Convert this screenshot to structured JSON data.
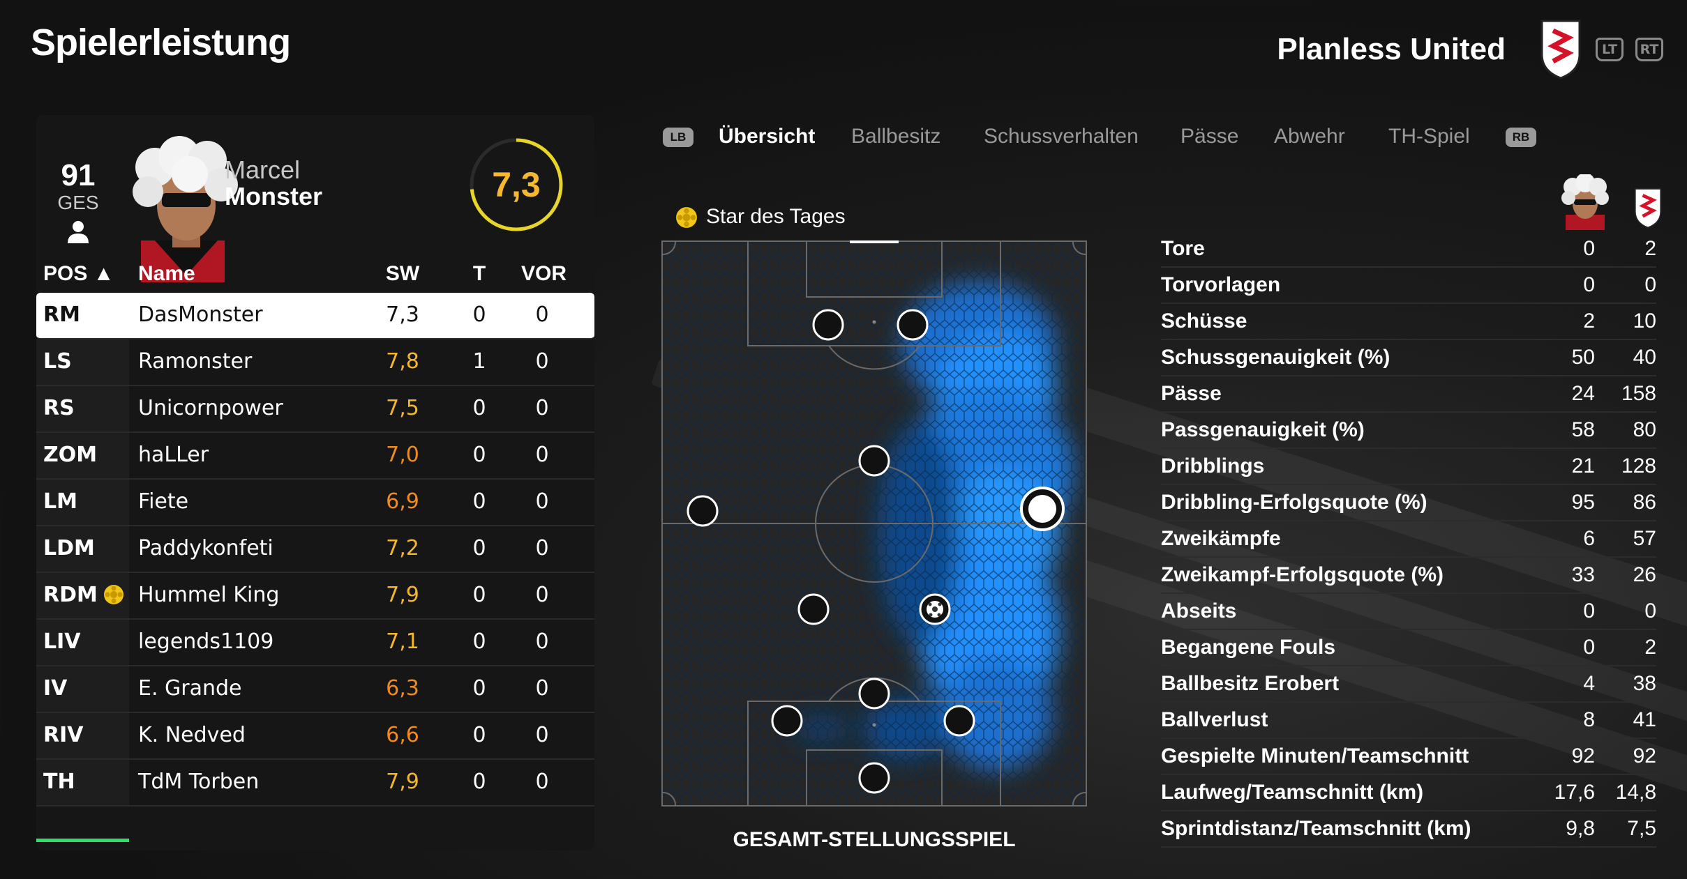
{
  "header": {
    "title": "Spielerleistung",
    "team_name": "Planless United",
    "lt_label": "LT",
    "rt_label": "RT"
  },
  "player": {
    "overall": "91",
    "overall_label": "GES",
    "first_name": "Marcel",
    "last_name": "Monster",
    "rating": "7,3"
  },
  "table": {
    "headers": {
      "pos": "POS ▲",
      "name": "Name",
      "sw": "SW",
      "t": "T",
      "vor": "VOR"
    },
    "rows": [
      {
        "pos": "RM",
        "name": "DasMonster",
        "sw": "7,3",
        "t": "0",
        "vor": "0"
      },
      {
        "pos": "LS",
        "name": "Ramonster",
        "sw": "7,8",
        "t": "1",
        "vor": "0"
      },
      {
        "pos": "RS",
        "name": "Unicornpower",
        "sw": "7,5",
        "t": "0",
        "vor": "0"
      },
      {
        "pos": "ZOM",
        "name": "haLLer",
        "sw": "7,0",
        "t": "0",
        "vor": "0"
      },
      {
        "pos": "LM",
        "name": "Fiete",
        "sw": "6,9",
        "t": "0",
        "vor": "0"
      },
      {
        "pos": "LDM",
        "name": "Paddykonfeti",
        "sw": "7,2",
        "t": "0",
        "vor": "0"
      },
      {
        "pos": "RDM",
        "name": "Hummel King",
        "sw": "7,9",
        "t": "0",
        "vor": "0"
      },
      {
        "pos": "LIV",
        "name": "legends1109",
        "sw": "7,1",
        "t": "0",
        "vor": "0"
      },
      {
        "pos": "IV",
        "name": "E. Grande",
        "sw": "6,3",
        "t": "0",
        "vor": "0"
      },
      {
        "pos": "RIV",
        "name": "K. Nedved",
        "sw": "6,6",
        "t": "0",
        "vor": "0"
      },
      {
        "pos": "TH",
        "name": "TdM Torben",
        "sw": "7,9",
        "t": "0",
        "vor": "0"
      }
    ]
  },
  "tabs": {
    "lb": "LB",
    "rb": "RB",
    "items": [
      "Übersicht",
      "Ballbesitz",
      "Schussverhalten",
      "Pässe",
      "Abwehr",
      "TH-Spiel"
    ]
  },
  "potd_label": "Star des Tages",
  "pitch_label": "GESAMT-STELLUNGSSPIEL",
  "stats": [
    {
      "label": "Tore",
      "a": "0",
      "b": "2"
    },
    {
      "label": "Torvorlagen",
      "a": "0",
      "b": "0"
    },
    {
      "label": "Schüsse",
      "a": "2",
      "b": "10"
    },
    {
      "label": "Schussgenauigkeit (%)",
      "a": "50",
      "b": "40"
    },
    {
      "label": "Pässe",
      "a": "24",
      "b": "158"
    },
    {
      "label": "Passgenauigkeit (%)",
      "a": "58",
      "b": "80"
    },
    {
      "label": "Dribblings",
      "a": "21",
      "b": "128"
    },
    {
      "label": "Dribbling-Erfolgsquote (%)",
      "a": "95",
      "b": "86"
    },
    {
      "label": "Zweikämpfe",
      "a": "6",
      "b": "57"
    },
    {
      "label": "Zweikampf-Erfolgsquote (%)",
      "a": "33",
      "b": "26"
    },
    {
      "label": "Abseits",
      "a": "0",
      "b": "0"
    },
    {
      "label": "Begangene Fouls",
      "a": "0",
      "b": "2"
    },
    {
      "label": "Ballbesitz Erobert",
      "a": "4",
      "b": "38"
    },
    {
      "label": "Ballverlust",
      "a": "8",
      "b": "41"
    },
    {
      "label": "Gespielte Minuten/Teamschnitt",
      "a": "92",
      "b": "92"
    },
    {
      "label": "Laufweg/Teamschnitt (km)",
      "a": "17,6",
      "b": "14,8"
    },
    {
      "label": "Sprintdistanz/Teamschnitt (km)",
      "a": "9,8",
      "b": "7,5"
    }
  ],
  "colors": {
    "accent": "#f5b82e",
    "heat": "#1e8fff",
    "selected_row": "#ffffff",
    "green_bar": "#2ee06b"
  }
}
